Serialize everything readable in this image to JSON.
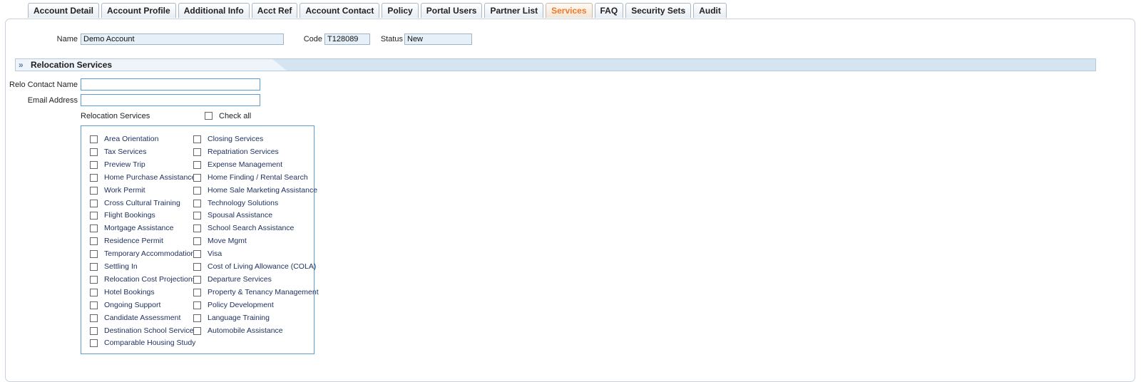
{
  "tabs": [
    {
      "label": "Account Detail",
      "active": false
    },
    {
      "label": "Account Profile",
      "active": false
    },
    {
      "label": "Additional Info",
      "active": false
    },
    {
      "label": "Acct Ref",
      "active": false
    },
    {
      "label": "Account Contact",
      "active": false
    },
    {
      "label": "Policy",
      "active": false
    },
    {
      "label": "Portal Users",
      "active": false
    },
    {
      "label": "Partner List",
      "active": false
    },
    {
      "label": "Services",
      "active": true
    },
    {
      "label": "FAQ",
      "active": false
    },
    {
      "label": "Security Sets",
      "active": false
    },
    {
      "label": "Audit",
      "active": false
    }
  ],
  "header": {
    "name_label": "Name",
    "name_value": "Demo Account",
    "code_label": "Code",
    "code_value": "T128089",
    "status_label": "Status",
    "status_value": "New"
  },
  "section": {
    "title": "Relocation Services"
  },
  "form": {
    "relo_contact_label": "Relo Contact Name",
    "relo_contact_value": "",
    "email_label": "Email Address",
    "email_value": "",
    "services_label": "Relocation Services",
    "check_all_label": "Check all"
  },
  "services": {
    "left": [
      "Area Orientation",
      "Tax Services",
      "Preview Trip",
      "Home Purchase Assistance",
      "Work Permit",
      "Cross Cultural Training",
      "Flight Bookings",
      "Mortgage Assistance",
      "Residence Permit",
      "Temporary Accommodations",
      "Settling In",
      "Relocation Cost Projections",
      "Hotel Bookings",
      "Ongoing Support",
      "Candidate Assessment",
      "Destination School Services",
      "Comparable Housing Study"
    ],
    "right": [
      "Closing Services",
      "Repatriation Services",
      "Expense Management",
      "Home Finding / Rental Search",
      "Home Sale Marketing Assistance",
      "Technology Solutions",
      "Spousal Assistance",
      "School Search Assistance",
      "Move Mgmt",
      "Visa",
      "Cost of Living Allowance (COLA)",
      "Departure Services",
      "Property & Tenancy Management",
      "Policy Development",
      "Language Training",
      "Automobile Assistance"
    ]
  },
  "colors": {
    "active_tab": "#f07a28",
    "section_bar": "#d5e4f1",
    "input_border": "#5a9dd6"
  }
}
